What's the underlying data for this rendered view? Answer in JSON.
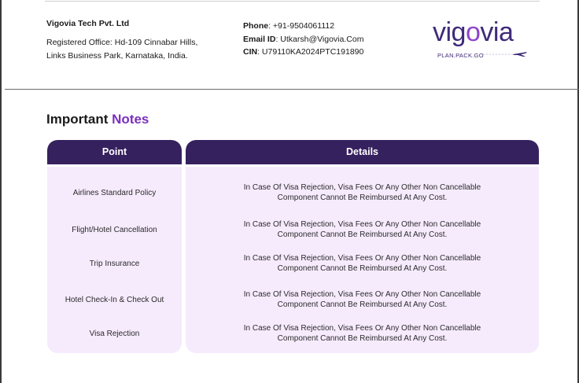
{
  "header": {
    "company_name": "Vigovia Tech Pvt. Ltd",
    "office_line1": "Registered Office: Hd-109 Cinnabar Hills,",
    "office_line2": "Links Business Park,   Karnataka, India.",
    "phone_label": "Phone",
    "phone_value": ": +91-9504061112",
    "email_label": "Email ID",
    "email_value": ": Utkarsh@Vigovia.Com",
    "cin_label": "CIN",
    "cin_value": ": U79110KA2024PTC191890"
  },
  "logo": {
    "word_start": "vig",
    "word_o": "o",
    "word_end": "via",
    "tagline": "PLAN.PACK.GO",
    "icon": "airplane-icon",
    "colors": {
      "primary": "#3f2a78",
      "accent": "#8f45c9"
    }
  },
  "notes": {
    "title_part1": "Important",
    "title_part2": "Notes",
    "accent_color": "#7b2fbf",
    "header_color": "#36215f",
    "panel_color": "#f6ebfd",
    "columns": {
      "point": "Point",
      "details": "Details"
    },
    "rows": [
      {
        "point": "Airlines Standard Policy",
        "details_line1": "In Case Of Visa Rejection, Visa Fees Or Any Other Non Cancellable",
        "details_line2": "Component Cannot Be Reimbursed At Any  Cost."
      },
      {
        "point": "Flight/Hotel Cancellation",
        "details_line1": "In Case Of Visa Rejection, Visa Fees Or Any Other Non Cancellable",
        "details_line2": "Component Cannot Be Reimbursed At Any  Cost."
      },
      {
        "point": "Trip Insurance",
        "details_line1": "In Case Of Visa Rejection, Visa Fees Or Any Other Non Cancellable",
        "details_line2": "Component Cannot Be Reimbursed At Any  Cost."
      },
      {
        "point": "Hotel Check-In & Check Out",
        "details_line1": "In Case Of Visa Rejection, Visa Fees Or Any Other Non Cancellable",
        "details_line2": "Component Cannot Be Reimbursed At Any  Cost."
      },
      {
        "point": "Visa Rejection",
        "details_line1": "In Case Of Visa Rejection, Visa Fees Or Any Other Non Cancellable",
        "details_line2": "Component Cannot Be Reimbursed At Any  Cost."
      }
    ]
  }
}
